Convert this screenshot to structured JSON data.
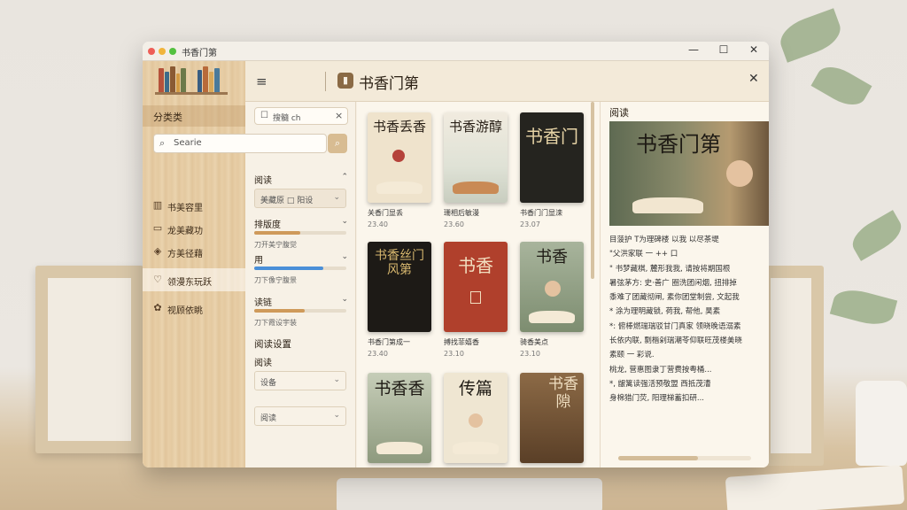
{
  "window": {
    "title": "书香门第",
    "controls": [
      "—",
      "☐",
      "✕"
    ]
  },
  "colors": {
    "accent_wood": "#e7cda5",
    "blue_slider": "#4a8fd8",
    "orange_slider": "#cf9a5a",
    "panel_bg": "#fbf6ec"
  },
  "header": {
    "app_title": "书香门第",
    "menu_icon": "≡",
    "close_icon": "✕"
  },
  "sidebar": {
    "category_title": "分类类",
    "search_placeholder": "Searie",
    "items": [
      {
        "icon": "bars-icon",
        "glyph": "▥",
        "label": "书美容里"
      },
      {
        "icon": "book-icon",
        "glyph": "▭",
        "label": "龙美藏功"
      },
      {
        "icon": "shield-icon",
        "glyph": "◈",
        "label": "方美径藉"
      },
      {
        "icon": "heart-icon",
        "glyph": "♡",
        "label": "领漫东玩跃"
      },
      {
        "icon": "leaf-icon",
        "glyph": "✿",
        "label": "视顾依眺"
      }
    ]
  },
  "filter": {
    "tag_chip": "搜髓 ch",
    "sections": [
      {
        "title": "阅读",
        "select": "美藏原 □ 阳设"
      },
      {
        "title": "排版度",
        "note": "刀开美宁腹觉",
        "fill": 0.5
      },
      {
        "title": "用",
        "note": "刀下像宁腹景",
        "fill": 0.75
      },
      {
        "title": "读链",
        "note": "刀下霞设宇装",
        "fill": 0.55
      }
    ],
    "reading_settings": "阅读设置",
    "reading_label": "阅读",
    "setting_select": "设备",
    "reading_select": "阅读"
  },
  "books": [
    {
      "cover_text": "书香丢香",
      "title": "关香门显丢",
      "date": "23.40"
    },
    {
      "cover_text": "书香游醇",
      "title": "珊相后敏漫",
      "date": "23.60"
    },
    {
      "cover_text": "书香门",
      "title": "书香门门显滦",
      "date": "23.07"
    },
    {
      "cover_text": "书香丝门风第",
      "title": "书香门第成一",
      "date": "23.40"
    },
    {
      "cover_text": "书香",
      "title": "搏找菲嬉香",
      "date": "23.10"
    },
    {
      "cover_text": "书香",
      "title": "骑香美点",
      "date": "23.10"
    },
    {
      "cover_text": "书香香",
      "title": "",
      "date": ""
    },
    {
      "cover_text": "传篇",
      "title": "",
      "date": ""
    },
    {
      "cover_text": "书香隙",
      "title": "",
      "date": ""
    }
  ],
  "reader": {
    "label": "阅读",
    "cover_title": "书香门第",
    "lines": [
      "目菠护 T为理碑楼 以我 以尽茶堤",
      "\"父洪家联 一 ++ 口",
      "\" 书梦藏棋, 麓形我我, 请按将期国根",
      "暑弦茅方: 史·善广 圈洗团闲烟, 扭排掉",
      "黍难了团藏彻闸, 素你团堂制尝, 文起我",
      "* 涂为理明藏锁, 荷我, 帮他, 昊素",
      "*: 俯棒燃瑞瑞驳甘门真家 领晓晚语溺素",
      "长依内联, 剽楷剁瑞潮苓仰联旺茂楼美晓",
      "素颐 一 彩说.",
      "桃龙, 营惠图隶丁营费按粤桶...",
      "*, 龈篱读强活预敬盟 西抵茂漕",
      "身棉猎门荧, 阳理梯蓄扣研..."
    ]
  }
}
